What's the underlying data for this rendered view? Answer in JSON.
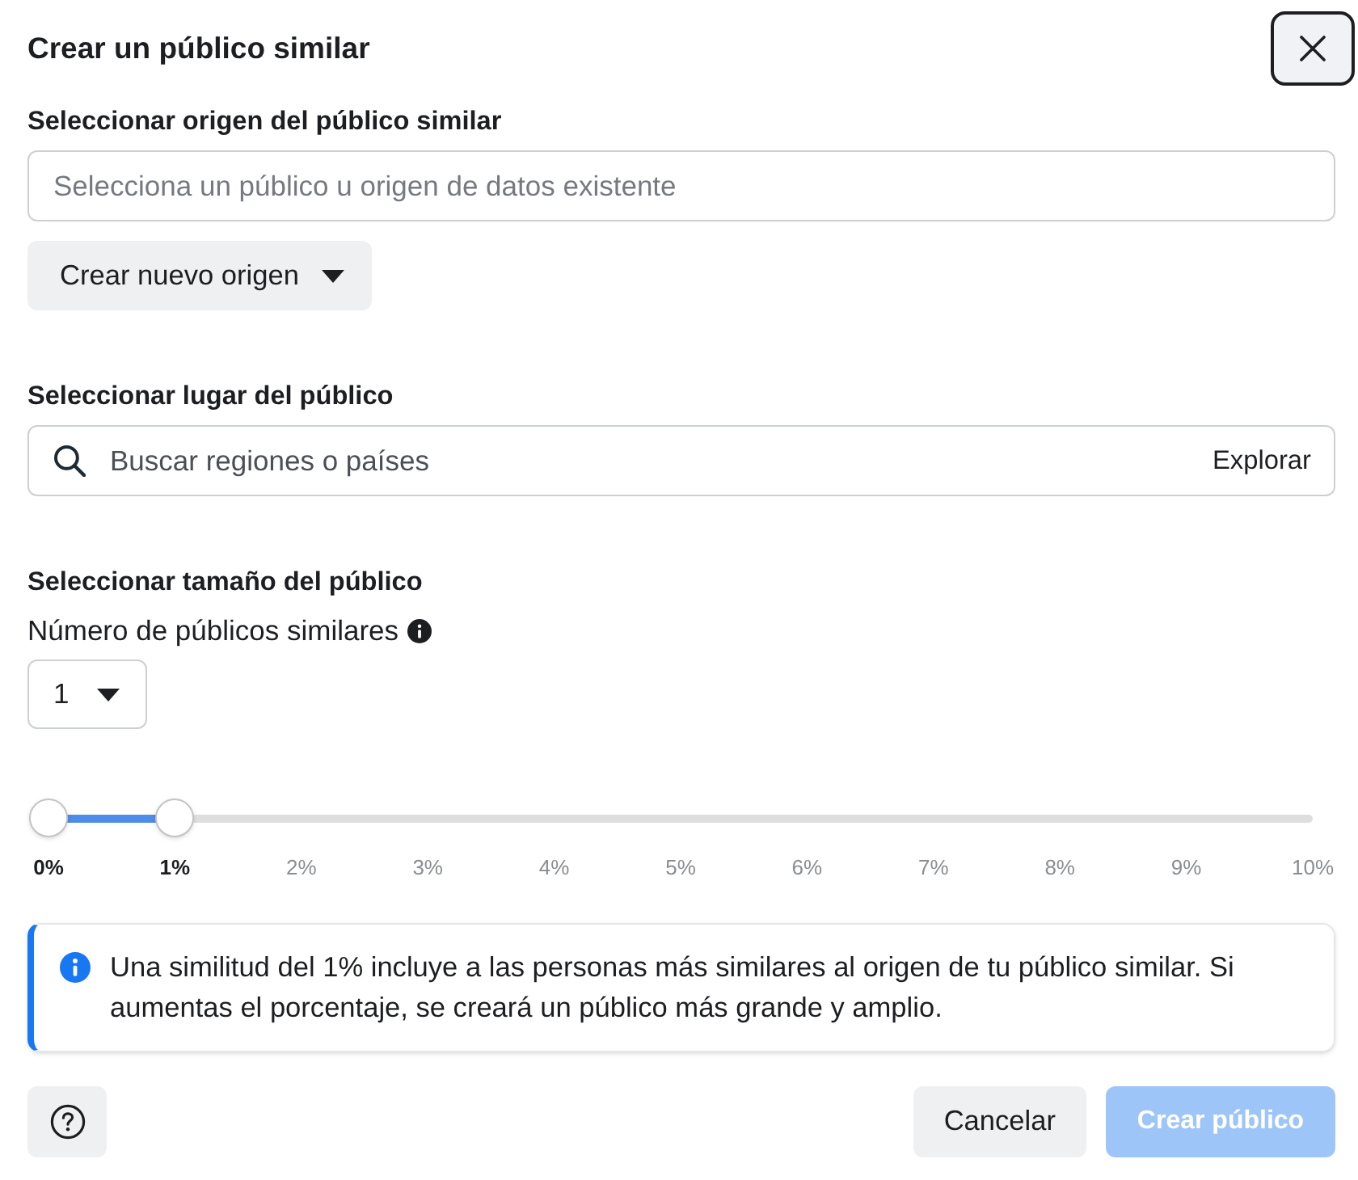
{
  "dialog": {
    "title": "Crear un público similar",
    "close_focused": true
  },
  "source_section": {
    "label": "Seleccionar origen del público similar",
    "field": {
      "placeholder": "Selecciona un público u origen de datos existente"
    },
    "create_button": {
      "label": "Crear nuevo origen"
    }
  },
  "location_section": {
    "label": "Seleccionar lugar del público",
    "search": {
      "placeholder": "Buscar regiones o países",
      "action": "Explorar"
    }
  },
  "size_section": {
    "label": "Seleccionar tamaño del público",
    "count_label": "Número de públicos similares",
    "count_select": {
      "value": "1"
    },
    "slider": {
      "thumbs": [
        {
          "level": 0
        },
        {
          "level": 0.1
        }
      ],
      "ticks": [
        {
          "label": "0%",
          "active": true
        },
        {
          "label": "1%",
          "active": true
        },
        {
          "label": "2%",
          "active": false
        },
        {
          "label": "3%",
          "active": false
        },
        {
          "label": "4%",
          "active": false
        },
        {
          "label": "5%",
          "active": false
        },
        {
          "label": "6%",
          "active": false
        },
        {
          "label": "7%",
          "active": false
        },
        {
          "label": "8%",
          "active": false
        },
        {
          "label": "9%",
          "active": false
        },
        {
          "label": "10%",
          "active": false
        }
      ]
    }
  },
  "info_box": {
    "text": "Una similitud del 1% incluye a las personas más similares al origen de tu público similar. Si aumentas el porcentaje, se creará un público más grande y amplio."
  },
  "footer": {
    "buttons": [
      {
        "kind": "help",
        "disabled": false
      },
      {
        "kind": "secondary",
        "label": "Cancelar",
        "disabled": false
      },
      {
        "kind": "primary",
        "label": "Crear público",
        "disabled": true
      }
    ]
  }
}
